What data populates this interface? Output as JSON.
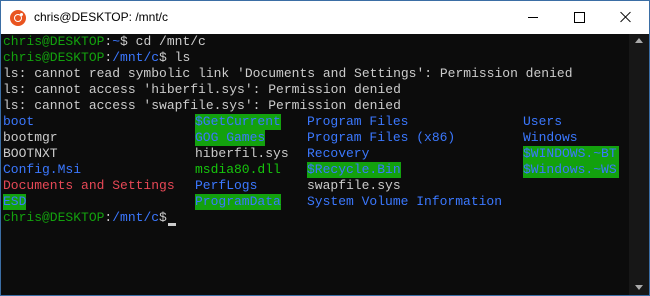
{
  "window": {
    "title": "chris@DESKTOP: /mnt/c",
    "icon": "ubuntu-icon",
    "controls": [
      "minimize-icon",
      "maximize-icon",
      "close-icon"
    ]
  },
  "terminal": {
    "colors": {
      "background": "#0c0c0c",
      "text": "#cccccc",
      "prompt_user": "#13a10e",
      "prompt_path": "#3b78ff",
      "directory": "#3b78ff",
      "highlight_bg": "#13a10e",
      "system_file": "#e74856",
      "executable": "#16c60c"
    },
    "lines": [
      {
        "user": "chris@DESKTOP",
        "sep": ":",
        "path": "~",
        "cmd": "$ cd /mnt/c"
      },
      {
        "user": "chris@DESKTOP",
        "sep": ":",
        "path": "/mnt/c",
        "cmd": "$ ls"
      },
      {
        "text": "ls: cannot read symbolic link 'Documents and Settings': Permission denied"
      },
      {
        "text": "ls: cannot access 'hiberfil.sys': Permission denied"
      },
      {
        "text": "ls: cannot access 'swapfile.sys': Permission denied"
      }
    ],
    "listing": {
      "columns": [
        [
          "boot",
          "bootmgr",
          "BOOTNXT",
          "Config.Msi",
          "Documents and Settings",
          "ESD"
        ],
        [
          "$GetCurrent",
          "GOG Games",
          "hiberfil.sys",
          "msdia80.dll",
          "PerfLogs",
          "ProgramData"
        ],
        [
          "Program Files",
          "Program Files (x86)",
          "Recovery",
          "$Recycle.Bin",
          "swapfile.sys",
          "System Volume Information"
        ],
        [
          "Users",
          "Windows",
          "$WINDOWS.~BT",
          "$Windows.~WS"
        ]
      ]
    },
    "final_prompt": {
      "user": "chris@DESKTOP",
      "sep": ":",
      "path": "/mnt/c",
      "cmd": "$"
    }
  }
}
